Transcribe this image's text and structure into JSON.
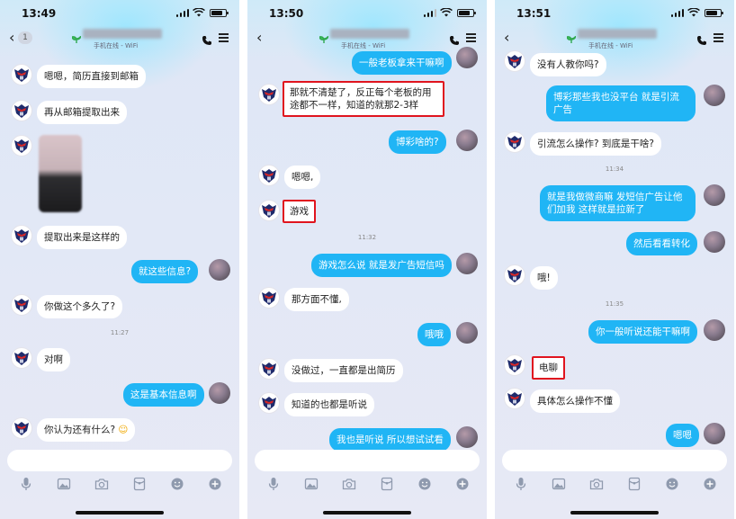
{
  "screens": [
    {
      "time": "13:49",
      "back_count": "1",
      "online_status": "手机在线 - WiFi",
      "messages": [
        {
          "text": "嗯嗯，简历直接到邮箱"
        },
        {
          "text": "再从邮箱提取出来"
        },
        {
          "text": "提取出来是这样的"
        },
        {
          "text": "就这些信息?"
        },
        {
          "text": "你做这个多久了?"
        },
        {
          "text": "11:27"
        },
        {
          "text": "对啊"
        },
        {
          "text": "这是基本信息啊"
        },
        {
          "text": "你认为还有什么?"
        }
      ]
    },
    {
      "time": "13:50",
      "online_status": "手机在线 - WiFi",
      "messages": [
        {
          "text": "一般老板拿来干嘛啊"
        },
        {
          "text": "那就不清楚了，反正每个老板的用途都不一样，知道的就那2-3样"
        },
        {
          "text": "博彩啥的?"
        },
        {
          "text": "嗯嗯,"
        },
        {
          "text": "游戏"
        },
        {
          "text": "11:32"
        },
        {
          "text": "游戏怎么说 就是发广告短信吗"
        },
        {
          "text": "那方面不懂,"
        },
        {
          "text": "哦哦"
        },
        {
          "text": "没做过，一直都是出简历"
        },
        {
          "text": "知道的也都是听说"
        },
        {
          "text": "我也是听说 所以想试试看"
        }
      ]
    },
    {
      "time": "13:51",
      "online_status": "手机在线 - WiFi",
      "messages": [
        {
          "text": "没有人教你吗?"
        },
        {
          "text": "博彩那些我也没平台 就是引流 广告"
        },
        {
          "text": "引流怎么操作? 到底是干啥?"
        },
        {
          "text": "11:34"
        },
        {
          "text": "就是我做微商嘛 发短信广告让他们加我 这样就是拉新了"
        },
        {
          "text": "然后看看转化"
        },
        {
          "text": "哦!"
        },
        {
          "text": "11:35"
        },
        {
          "text": "你一般听说还能干嘛啊"
        },
        {
          "text": "电聊"
        },
        {
          "text": "具体怎么操作不懂"
        },
        {
          "text": "嗯嗯"
        }
      ]
    }
  ],
  "colors": {
    "outgoing_bubble": "#20b5f5",
    "incoming_bubble": "#ffffff",
    "highlight_border": "#e0141e"
  },
  "icons": [
    "back-chevron-icon",
    "signal-icon",
    "wifi-icon",
    "battery-icon",
    "leaf-icon",
    "phone-call-icon",
    "menu-icon",
    "microphone-icon",
    "image-icon",
    "camera-icon",
    "red-packet-icon",
    "emoji-icon",
    "plus-icon"
  ]
}
